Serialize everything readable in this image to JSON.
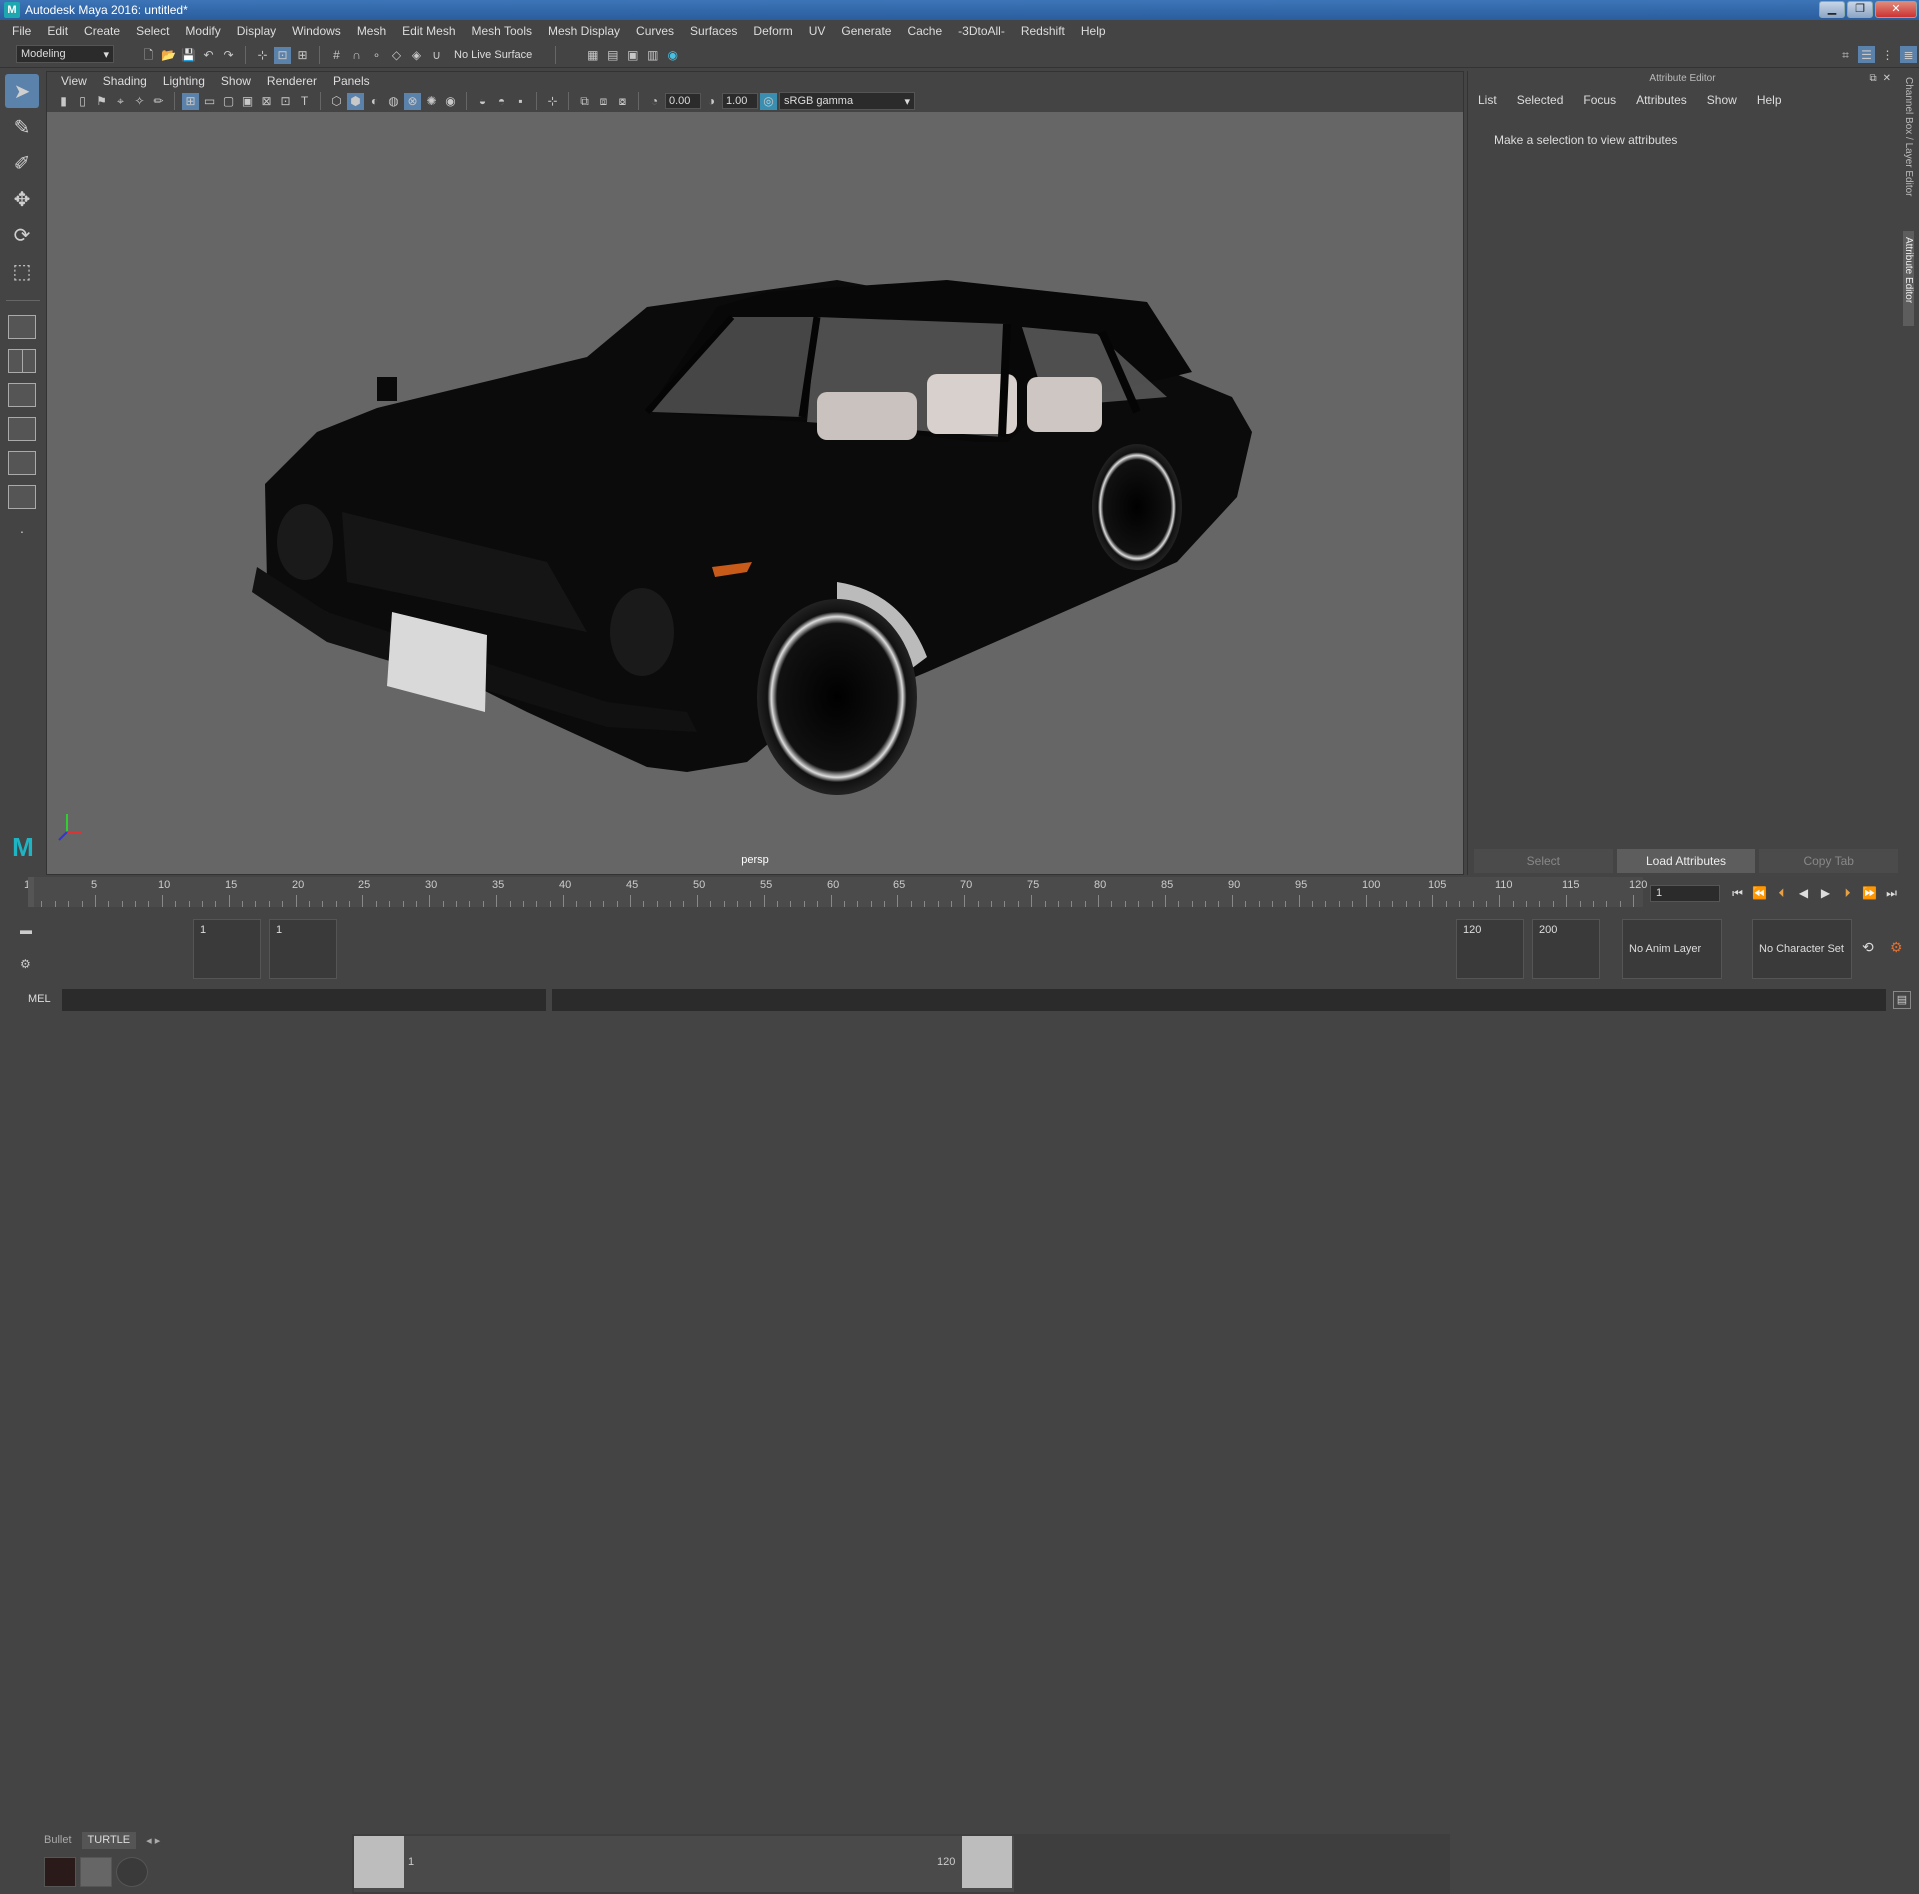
{
  "window": {
    "title": "Autodesk Maya 2016: untitled*",
    "minimize": "▁",
    "restore": "❐",
    "close": "✕"
  },
  "menubar": [
    "File",
    "Edit",
    "Create",
    "Select",
    "Modify",
    "Display",
    "Windows",
    "Mesh",
    "Edit Mesh",
    "Mesh Tools",
    "Mesh Display",
    "Curves",
    "Surfaces",
    "Deform",
    "UV",
    "Generate",
    "Cache",
    "-3DtoAll-",
    "Redshift",
    "Help"
  ],
  "status_line": {
    "mode": "Modeling",
    "live_surface": "No Live Surface"
  },
  "viewport": {
    "menu": [
      "View",
      "Shading",
      "Lighting",
      "Show",
      "Renderer",
      "Panels"
    ],
    "exposure": "0.00",
    "gamma": "1.00",
    "color_space": "sRGB gamma",
    "camera_label": "persp"
  },
  "attribute_editor": {
    "title": "Attribute Editor",
    "menu": [
      "List",
      "Selected",
      "Focus",
      "Attributes",
      "Show",
      "Help"
    ],
    "message": "Make a selection to view attributes",
    "buttons": [
      "Select",
      "Load Attributes",
      "Copy Tab"
    ]
  },
  "side_tabs": [
    "Channel Box / Layer Editor",
    "Attribute Editor"
  ],
  "timeline": {
    "ticks": [
      "1",
      "5",
      "10",
      "15",
      "20",
      "25",
      "30",
      "35",
      "40",
      "45",
      "50",
      "55",
      "60",
      "65",
      "70",
      "75",
      "80",
      "85",
      "90",
      "95",
      "100",
      "105",
      "110",
      "115",
      "120"
    ],
    "current_frame": "1"
  },
  "range": {
    "shelf_tabs": [
      "Bullet",
      "TURTLE"
    ],
    "start_time": "1",
    "playback_start": "1",
    "slider_start": "1",
    "slider_end": "120",
    "playback_end": "120",
    "end_time": "200",
    "anim_layer": "No Anim Layer",
    "character_set": "No Character Set"
  },
  "command_line": {
    "label": "MEL"
  },
  "colors": {
    "accent": "#5b82aa",
    "viewport_bg": "#666666",
    "panel_bg": "#444444"
  }
}
